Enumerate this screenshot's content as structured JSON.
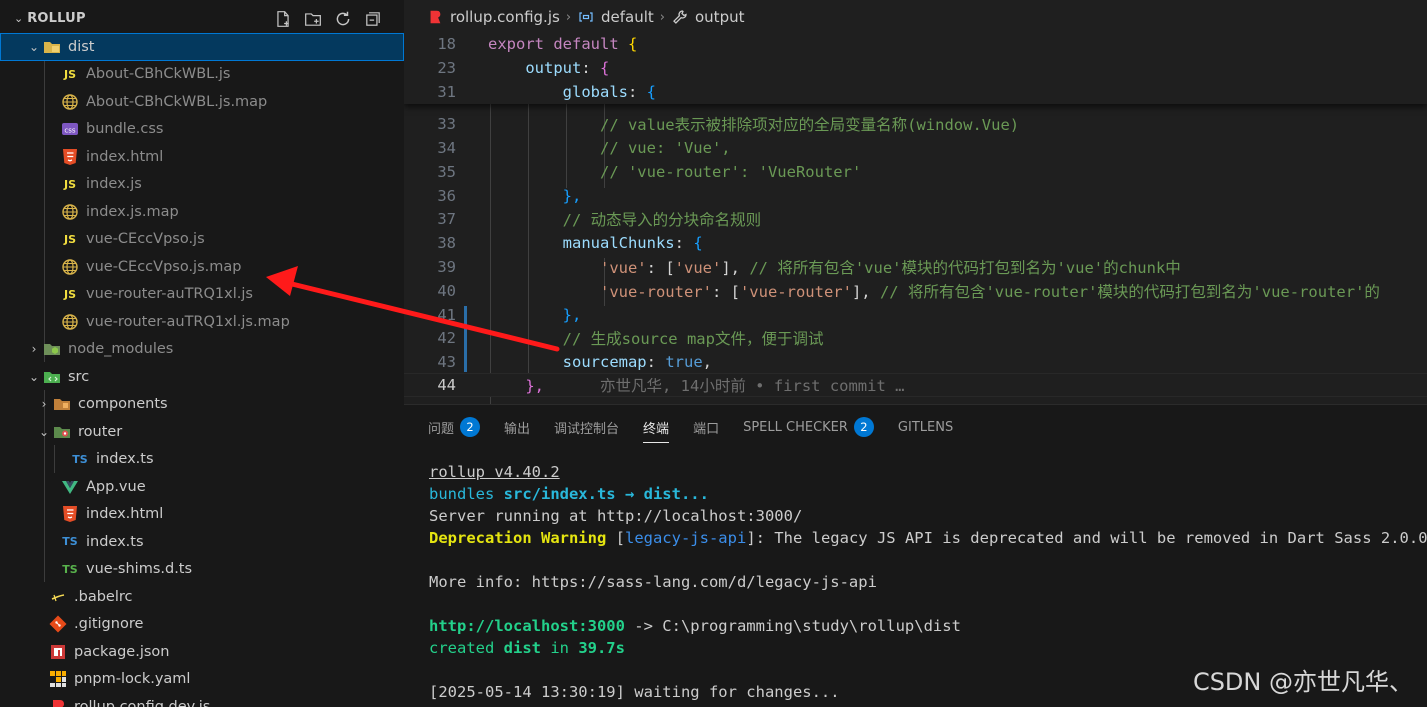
{
  "explorer": {
    "title": "ROLLUP",
    "items": [
      {
        "label": "dist",
        "type": "folder-open"
      },
      {
        "label": "About-CBhCkWBL.js",
        "type": "js"
      },
      {
        "label": "About-CBhCkWBL.js.map",
        "type": "map"
      },
      {
        "label": "bundle.css",
        "type": "css"
      },
      {
        "label": "index.html",
        "type": "html"
      },
      {
        "label": "index.js",
        "type": "js"
      },
      {
        "label": "index.js.map",
        "type": "map"
      },
      {
        "label": "vue-CEccVpso.js",
        "type": "js"
      },
      {
        "label": "vue-CEccVpso.js.map",
        "type": "map"
      },
      {
        "label": "vue-router-auTRQ1xl.js",
        "type": "js"
      },
      {
        "label": "vue-router-auTRQ1xl.js.map",
        "type": "map"
      },
      {
        "label": "node_modules",
        "type": "folder-closed"
      },
      {
        "label": "src",
        "type": "folder-open"
      },
      {
        "label": "components",
        "type": "folder-closed"
      },
      {
        "label": "router",
        "type": "folder-open"
      },
      {
        "label": "index.ts",
        "type": "ts"
      },
      {
        "label": "App.vue",
        "type": "vue"
      },
      {
        "label": "index.html",
        "type": "html"
      },
      {
        "label": "index.ts",
        "type": "ts"
      },
      {
        "label": "vue-shims.d.ts",
        "type": "dts"
      },
      {
        "label": ".babelrc",
        "type": "babel"
      },
      {
        "label": ".gitignore",
        "type": "git"
      },
      {
        "label": "package.json",
        "type": "npm"
      },
      {
        "label": "pnpm-lock.yaml",
        "type": "pnpm"
      },
      {
        "label": "rollup.config.dev.js",
        "type": "rollup"
      }
    ],
    "icon_labels": {
      "js": "JS",
      "ts": "TS",
      "css": "css"
    }
  },
  "breadcrumbs": {
    "file": "rollup.config.js",
    "symbol1": "default",
    "symbol2": "output"
  },
  "sticky_lines": {
    "l1": {
      "num": "18",
      "a": "export",
      "b": " default ",
      "c": "{"
    },
    "l2": {
      "num": "23",
      "a": "output",
      "b": ": ",
      "c": "{"
    },
    "l3": {
      "num": "31",
      "a": "globals",
      "b": ": ",
      "c": "{"
    }
  },
  "code": {
    "l33": {
      "num": "33",
      "text": "// value表示被排除项对应的全局变量名称(window.Vue)"
    },
    "l34": {
      "num": "34",
      "text": "// vue: 'Vue',"
    },
    "l35": {
      "num": "35",
      "text": "// 'vue-router': 'VueRouter'"
    },
    "l36": {
      "num": "36",
      "text": "},"
    },
    "l37": {
      "num": "37",
      "text": "// 动态导入的分块命名规则"
    },
    "l38": {
      "num": "38",
      "prop": "manualChunks",
      "rest": ": ",
      "brace": "{"
    },
    "l39": {
      "num": "39",
      "key": "'vue'",
      "mid": ": [",
      "val": "'vue'",
      "end": "], ",
      "cmt": "// 将所有包含'vue'模块的代码打包到名为'vue'的chunk中"
    },
    "l40": {
      "num": "40",
      "key": "'vue-router'",
      "mid": ": [",
      "val": "'vue-router'",
      "end": "], ",
      "cmt": "// 将所有包含'vue-router'模块的代码打包到名为'vue-router'的"
    },
    "l41": {
      "num": "41",
      "text": "},"
    },
    "l42": {
      "num": "42",
      "text": "// 生成source map文件，便于调试"
    },
    "l43": {
      "num": "43",
      "prop": "sourcemap",
      "rest": ": ",
      "val": "true",
      "end": ","
    },
    "l44": {
      "num": "44",
      "text": "},",
      "blame": "亦世凡华, 14小时前 • first commit …"
    }
  },
  "panel": {
    "tabs": [
      {
        "label": "问题",
        "badge": "2"
      },
      {
        "label": "输出"
      },
      {
        "label": "调试控制台"
      },
      {
        "label": "终端"
      },
      {
        "label": "端口"
      },
      {
        "label": "SPELL CHECKER",
        "badge": "2"
      },
      {
        "label": "GITLENS"
      }
    ],
    "active_tab": "终端"
  },
  "terminal": {
    "line1": "rollup v4.40.2",
    "line2a": "bundles ",
    "line2b": "src/index.ts → dist...",
    "line3": "Server running at http://localhost:3000/",
    "line4a": "Deprecation Warning",
    "line4b": " [",
    "line4c": "legacy-js-api",
    "line4d": "]: The legacy JS API is deprecated and will be removed in Dart Sass 2.0.0.",
    "line5": "More info: https://sass-lang.com/d/legacy-js-api",
    "line6a": "http://localhost:3000",
    "line6b": " -> C:\\programming\\study\\rollup\\dist",
    "line7a": "created ",
    "line7b": "dist",
    "line7c": " in ",
    "line7d": "39.7s",
    "line8": "[2025-05-14 13:30:19] waiting for changes..."
  },
  "watermark": "CSDN @亦世凡华、",
  "colors": {
    "selection": "#04395e",
    "accent": "#0078d4",
    "arrow": "#ff1a1a"
  }
}
